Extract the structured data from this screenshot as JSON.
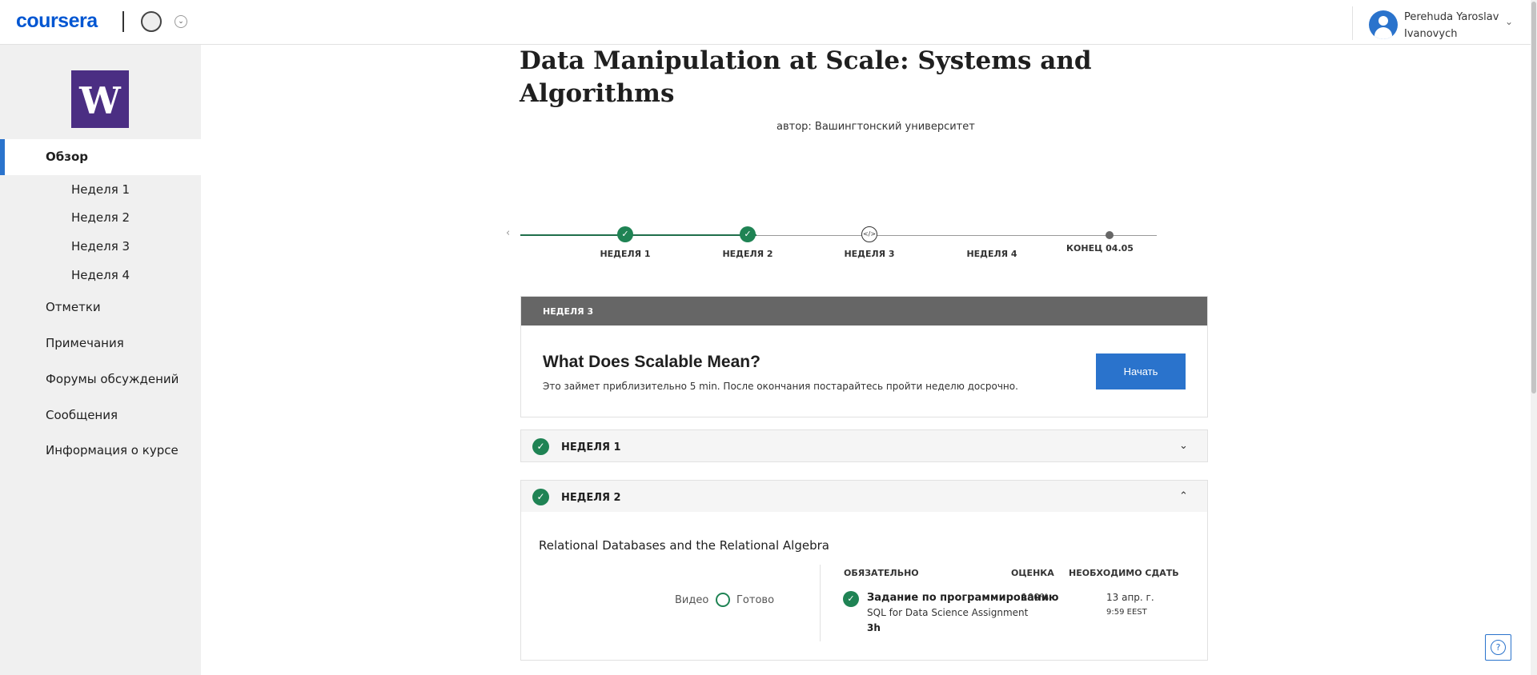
{
  "header": {
    "logo": "coursera",
    "user_name_line1": "Perehuda Yaroslav",
    "user_name_line2": "Ivanovych",
    "icons": [
      "partner-logo-icon",
      "chevron-down-icon",
      "user-avatar-icon"
    ]
  },
  "sidebar": {
    "logo_letter": "W",
    "overview": "Обзор",
    "weeks": [
      "Неделя 1",
      "Неделя 2",
      "Неделя 3",
      "Неделя 4"
    ],
    "items": [
      "Отметки",
      "Примечания",
      "Форумы обсуждений",
      "Сообщения",
      "Информация о курсе"
    ]
  },
  "course": {
    "title": "Data Manipulation at Scale: Systems and Algorithms",
    "author": "автор: Вашингтонский университет"
  },
  "timeline": {
    "labels": [
      "НЕДЕЛЯ 1",
      "НЕДЕЛЯ 2",
      "НЕДЕЛЯ 3",
      "НЕДЕЛЯ 4",
      "КОНЕЦ 04.05"
    ],
    "completed_weeks": 2,
    "current_week": 3,
    "code_icon": "</>"
  },
  "current_week_card": {
    "header": "НЕДЕЛЯ 3",
    "title": "What Does Scalable Mean?",
    "subtitle": "Это займет приблизительно 5 min. После окончания постарайтесь пройти неделю досрочно.",
    "start_label": "Начать"
  },
  "accordion": {
    "week1_label": "НЕДЕЛЯ 1",
    "week2_label": "НЕДЕЛЯ 2"
  },
  "week2": {
    "lesson_title": "Relational Databases and the Relational Algebra",
    "video_label": "Видео",
    "done_label": "Готово",
    "columns": {
      "required": "ОБЯЗАТЕЛЬНО",
      "grade": "ОЦЕНКА",
      "due": "НЕОБХОДИМО СДАТЬ"
    },
    "assignment": {
      "title": "Задание по программированию",
      "subtitle": "SQL for Data Science Assignment",
      "duration": "3h",
      "grade": "100%",
      "due_date": "13 апр. г.",
      "due_time": "9:59 EEST"
    }
  },
  "colors": {
    "brand_blue": "#2a73cc",
    "coursera_blue": "#0056d2",
    "success_green": "#1f8354",
    "uw_purple": "#4b2e83"
  }
}
